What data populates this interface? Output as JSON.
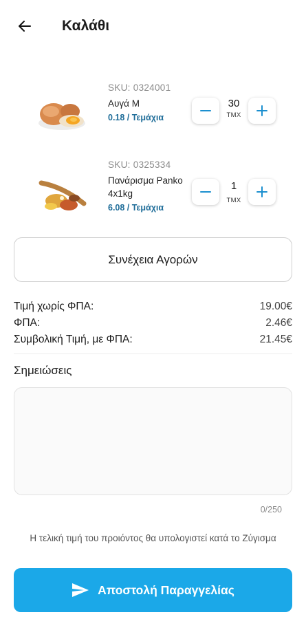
{
  "header": {
    "title": "Καλάθι",
    "back_icon": "arrow-left-icon"
  },
  "cart": {
    "items": [
      {
        "sku": "SKU: 0324001",
        "name": "Αυγά Μ",
        "unit_price": "0.18 / Τεμάχια",
        "quantity": "30",
        "unit": "ΤΜΧ",
        "image_icon": "eggs-image"
      },
      {
        "sku": "SKU: 0325334",
        "name": "Πανάρισμα Panko 4x1kg",
        "unit_price": "6.08 / Τεμάχια",
        "quantity": "1",
        "unit": "ΤΜΧ",
        "image_icon": "breadcrumbs-image"
      }
    ]
  },
  "continue_label": "Συνέχεια Αγορών",
  "totals": [
    {
      "label": "Τιμή χωρίς ΦΠΑ:",
      "value": "19.00€"
    },
    {
      "label": "ΦΠΑ:",
      "value": "2.46€"
    },
    {
      "label": "Συμβολική Τιμή, με ΦΠΑ:",
      "value": "21.45€"
    }
  ],
  "notes": {
    "label": "Σημειώσεις",
    "value": "",
    "counter": "0/250"
  },
  "footnote": "Η τελική τιμή του προιόντος θα υπολογιστεί κατά το Ζύγισμα",
  "submit": {
    "label": "Αποστολή Παραγγελίας",
    "icon": "send-icon"
  },
  "colors": {
    "accent": "#1ba8e8",
    "price_link": "#1f6d99"
  }
}
